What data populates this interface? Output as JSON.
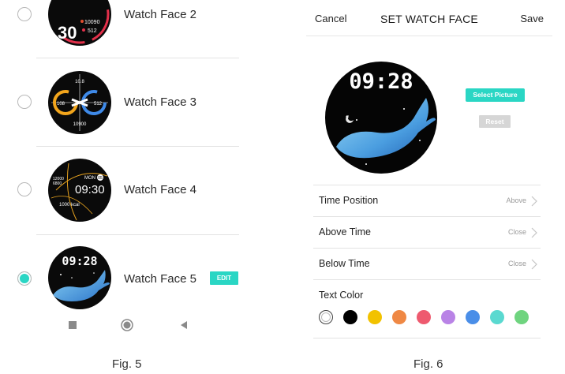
{
  "left": {
    "rows": [
      {
        "label": "Watch Face 2",
        "selected": false
      },
      {
        "label": "Watch Face 3",
        "selected": false
      },
      {
        "label": "Watch Face 4",
        "selected": false
      },
      {
        "label": "Watch Face 5",
        "selected": true
      }
    ],
    "edit_label": "EDIT",
    "wf2": {
      "big": "30",
      "steps": "10090",
      "hr": "512"
    },
    "wf3": {
      "top": "10.8",
      "left": "108",
      "right": "512",
      "bottom": "10900"
    },
    "wf4": {
      "day": "MON",
      "date": "05",
      "time": "09:30",
      "kcal": "1000 kcal",
      "steps": "12000",
      "steps2": "6800"
    },
    "wf5": {
      "time": "09:28"
    },
    "navbar_icons": [
      "square-recents-icon",
      "circle-home-icon",
      "triangle-back-icon"
    ],
    "caption": "Fig. 5"
  },
  "right": {
    "cancel": "Cancel",
    "title": "SET WATCH FACE",
    "save": "Save",
    "preview_time": "09:28",
    "select_picture": "Select Picture",
    "reset": "Reset",
    "settings": [
      {
        "label": "Time Position",
        "value": "Above"
      },
      {
        "label": "Above Time",
        "value": "Close"
      },
      {
        "label": "Below Time",
        "value": "Close"
      }
    ],
    "text_color_label": "Text Color",
    "swatches": [
      "#ffffff",
      "#000000",
      "#f2c200",
      "#ef8844",
      "#ee5a6f",
      "#b983e6",
      "#4a8ee8",
      "#5ad9d0",
      "#6fd47f"
    ],
    "selected_swatch": 0,
    "caption": "Fig. 6"
  }
}
